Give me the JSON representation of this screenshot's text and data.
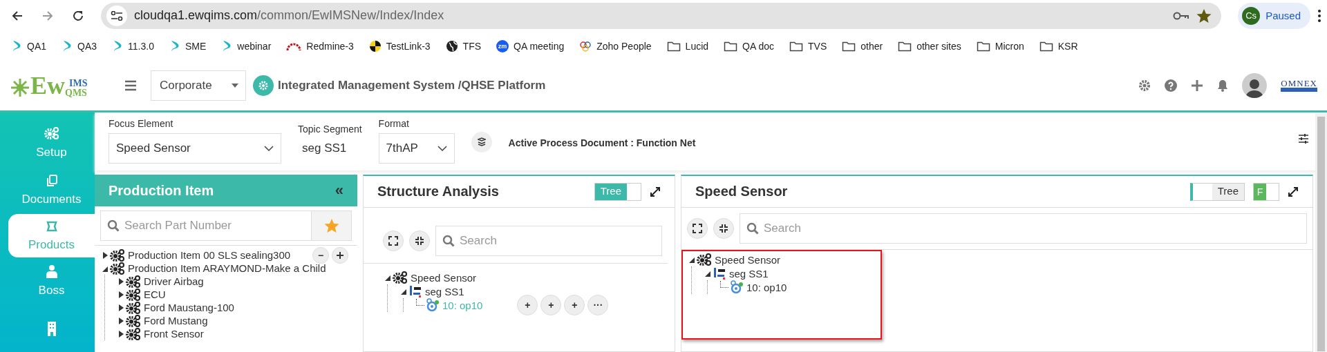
{
  "browser": {
    "url_host": "cloudqa1.ewqims.com",
    "url_path": "/common/EwIMSNew/Index/Index",
    "profile_initials": "Cs",
    "profile_status": "Paused"
  },
  "bookmarks": [
    {
      "label": "QA1",
      "kind": "ew"
    },
    {
      "label": "QA3",
      "kind": "ew"
    },
    {
      "label": "11.3.0",
      "kind": "ew"
    },
    {
      "label": "SME",
      "kind": "ew"
    },
    {
      "label": "webinar",
      "kind": "ew"
    },
    {
      "label": "Redmine-3",
      "kind": "redmine"
    },
    {
      "label": "TestLink-3",
      "kind": "testlink"
    },
    {
      "label": "TFS",
      "kind": "globe"
    },
    {
      "label": "QA meeting",
      "kind": "zm",
      "badge": "zm"
    },
    {
      "label": "Zoho People",
      "kind": "zoho"
    },
    {
      "label": "Lucid",
      "kind": "folder"
    },
    {
      "label": "QA doc",
      "kind": "folder"
    },
    {
      "label": "TVS",
      "kind": "folder"
    },
    {
      "label": "other",
      "kind": "folder"
    },
    {
      "label": "other sites",
      "kind": "folder"
    },
    {
      "label": "Micron",
      "kind": "folder"
    },
    {
      "label": "KSR",
      "kind": "folder"
    }
  ],
  "app_header": {
    "logo_main": "Ew",
    "logo_top": "IMS",
    "logo_sub": "QMS",
    "org_select": "Corporate",
    "platform_title": "Integrated Management System /QHSE Platform",
    "brand": "OMNEX"
  },
  "sidebar": {
    "items": [
      {
        "label": "Setup",
        "kind": "gears",
        "selected": false
      },
      {
        "label": "Documents",
        "kind": "documents",
        "selected": false
      },
      {
        "label": "Products",
        "kind": "products",
        "selected": true
      },
      {
        "label": "Boss",
        "kind": "person",
        "selected": false
      },
      {
        "kind": "building",
        "selected": false
      }
    ]
  },
  "filters": {
    "focus_element": {
      "label": "Focus Element",
      "value": "Speed Sensor"
    },
    "topic_segment": {
      "label": "Topic Segment",
      "value": "seg SS1"
    },
    "format": {
      "label": "Format",
      "value": "7thAP"
    },
    "active_document": "Active Process Document : Function Net"
  },
  "production_panel": {
    "title": "Production Item",
    "collapse_glyph": "«",
    "search_placeholder": "Search Part Number",
    "tree": [
      {
        "label": "Production Item 00 SLS sealing300",
        "kind": "gears",
        "expanded": false,
        "actions": [
          "−"
        ],
        "clipped_action": true
      },
      {
        "label": "Production Item ARAYMOND-Make a Child",
        "kind": "gears",
        "expanded": true,
        "children": [
          {
            "label": "Driver Airbag",
            "kind": "gears",
            "expanded": false
          },
          {
            "label": "ECU",
            "kind": "gears",
            "expanded": false
          },
          {
            "label": "Ford Maustang-100",
            "kind": "gears",
            "expanded": false
          },
          {
            "label": "Ford Mustang",
            "kind": "gears",
            "expanded": false
          },
          {
            "label": "Front Sensor",
            "kind": "gears",
            "expanded": false
          }
        ]
      }
    ]
  },
  "structure_panel": {
    "title": "Structure Analysis",
    "toggle": {
      "label": "Tree",
      "on": true
    },
    "search_placeholder": "Search",
    "highlighted": false,
    "tree": [
      {
        "label": "Speed Sensor",
        "kind": "gears",
        "expanded": true,
        "children": [
          {
            "label": "seg SS1",
            "kind": "segment",
            "expanded": true,
            "children": [
              {
                "label": "10: op10",
                "kind": "operation",
                "selected": true,
                "actions": [
                  "+",
                  "+",
                  "+",
                  "···"
                ]
              }
            ]
          }
        ]
      }
    ]
  },
  "detail_panel": {
    "title": "Speed Sensor",
    "toggle": {
      "label": "Tree",
      "on": false
    },
    "f_toggle": {
      "label": "F",
      "on": true
    },
    "search_placeholder": "Search",
    "highlighted": true,
    "tree": [
      {
        "label": "Speed Sensor",
        "kind": "gears",
        "expanded": true,
        "children": [
          {
            "label": "seg SS1",
            "kind": "segment",
            "expanded": true,
            "children": [
              {
                "label": "10: op10",
                "kind": "operation",
                "selected": false
              }
            ]
          }
        ]
      }
    ]
  }
}
